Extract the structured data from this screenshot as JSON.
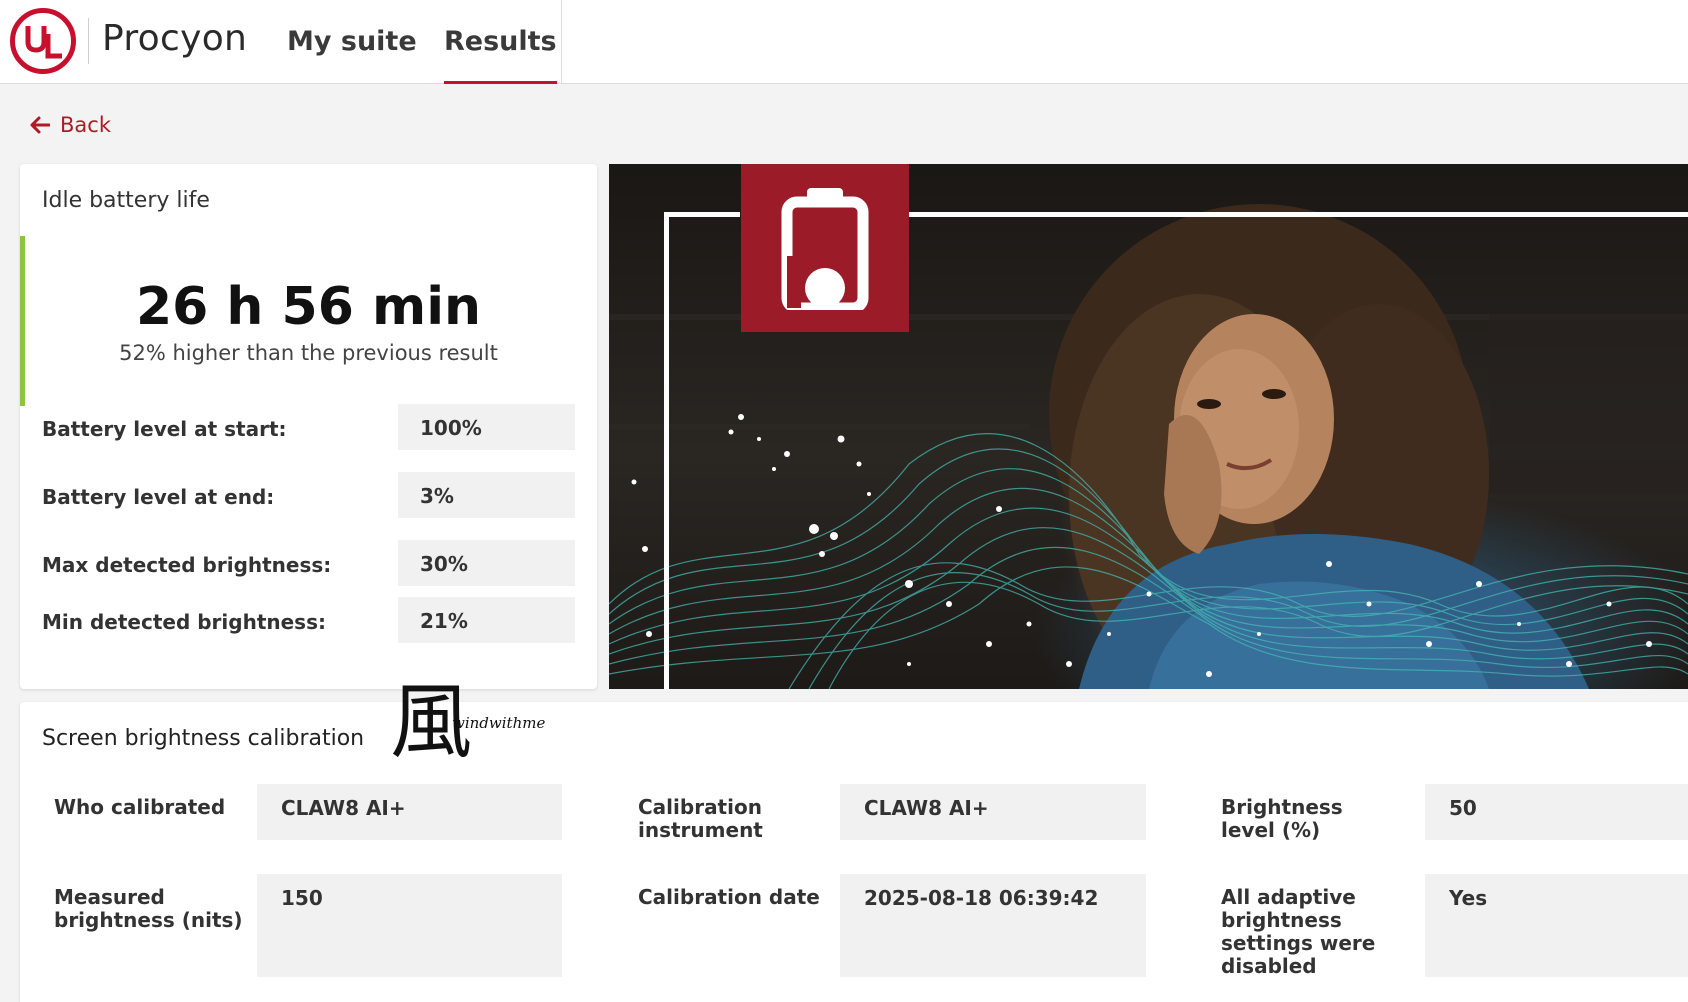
{
  "header": {
    "brand": "Procyon",
    "tabs": [
      {
        "label": "My suite",
        "active": false
      },
      {
        "label": "Results",
        "active": true
      }
    ],
    "accent_color": "#c8102e"
  },
  "back": {
    "label": "Back",
    "icon": "arrow-left-icon"
  },
  "battery": {
    "title": "Idle battery life",
    "value": "26 h 56 min",
    "comparison": "52% higher than the previous result",
    "accent_color": "#8cc63f",
    "rows": [
      {
        "label": "Battery level at start:",
        "value": "100%"
      },
      {
        "label": "Battery level at end:",
        "value": "3%"
      },
      {
        "label": "Max detected brightness:",
        "value": "30%"
      },
      {
        "label": "Min detected brightness:",
        "value": "21%"
      }
    ]
  },
  "hero": {
    "badge_icon": "battery-icon",
    "badge_color": "#9b1b28"
  },
  "calibration": {
    "title": "Screen brightness calibration",
    "fields": [
      {
        "label": "Who calibrated",
        "value": "CLAW8 AI+"
      },
      {
        "label": "Calibration instrument",
        "value": "CLAW8 AI+"
      },
      {
        "label": "Brightness level (%)",
        "value": "50"
      },
      {
        "label": "Measured brightness (nits)",
        "value": "150"
      },
      {
        "label": "Calibration date",
        "value": "2025-08-18 06:39:42"
      },
      {
        "label": "All adaptive brightness settings were disabled",
        "value": "Yes"
      }
    ]
  },
  "watermark": {
    "glyph": "風",
    "text": "windwithme"
  }
}
